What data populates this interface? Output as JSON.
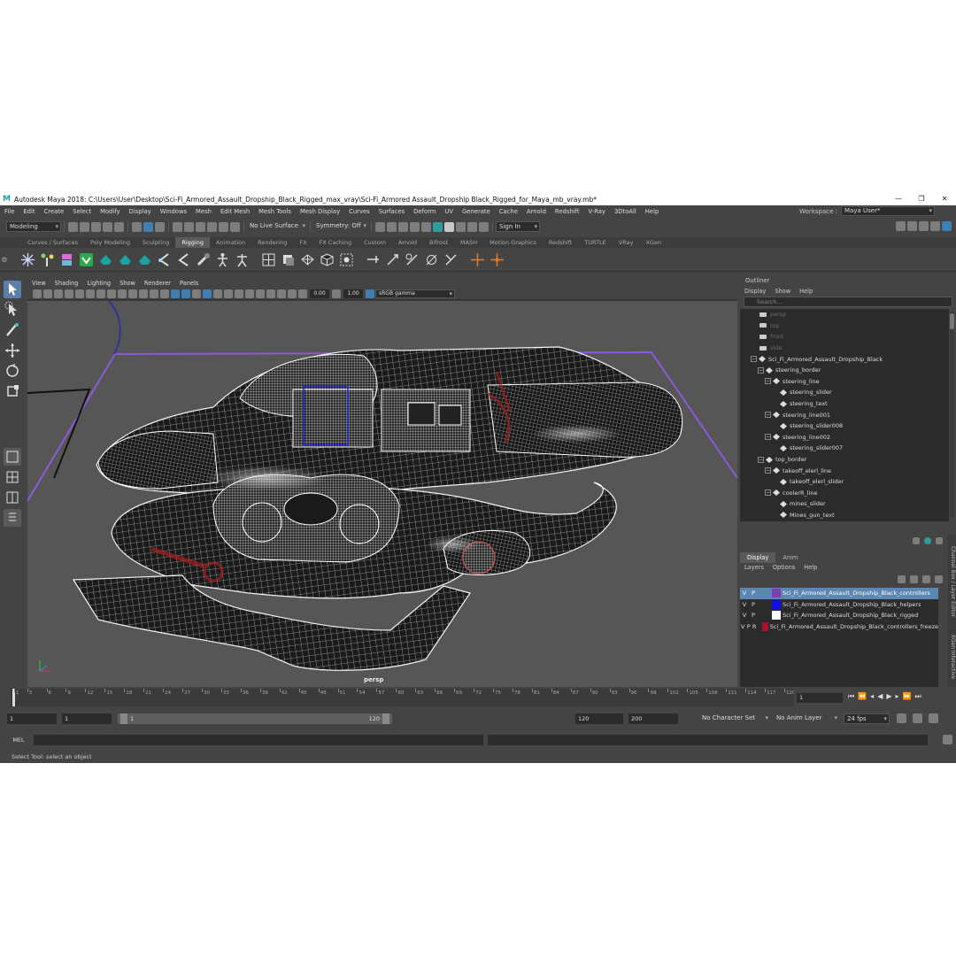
{
  "window": {
    "title": "Autodesk Maya 2018: C:\\Users\\User\\Desktop\\Sci-Fi_Armored_Assault_Dropship_Black_Rigged_max_vray\\Sci-Fi_Armored Assault_Dropship Black_Rigged_for_Maya_mb_vray.mb*",
    "logo_glyph": "M"
  },
  "menubar": {
    "items": [
      "File",
      "Edit",
      "Create",
      "Select",
      "Modify",
      "Display",
      "Windows",
      "Mesh",
      "Edit Mesh",
      "Mesh Tools",
      "Mesh Display",
      "Curves",
      "Surfaces",
      "Deform",
      "UV",
      "Generate",
      "Cache",
      "Arnold",
      "Redshift",
      "V-Ray",
      "3DtoAll",
      "Help"
    ],
    "workspace_label": "Workspace :",
    "workspace_value": "Maya User*"
  },
  "statusline": {
    "menuset": "Modeling",
    "live_surface": "No Live Surface",
    "symmetry": "Symmetry: Off",
    "sign_in": "Sign In"
  },
  "shelf": {
    "tabs": [
      "Curves / Surfaces",
      "Poly Modeling",
      "Sculpting",
      "Rigging",
      "Animation",
      "Rendering",
      "FX",
      "FX Caching",
      "Custom",
      "Arnold",
      "Bifrost",
      "MASH",
      "Motion Graphics",
      "Redshift",
      "TURTLE",
      "VRay",
      "XGen"
    ],
    "active_tab": "Rigging"
  },
  "viewport": {
    "menu": [
      "View",
      "Shading",
      "Lighting",
      "Show",
      "Renderer",
      "Panels"
    ],
    "near_value": "0.00",
    "far_value": "1.00",
    "color_space": "sRGB gamma",
    "camera": "persp",
    "logo": "M"
  },
  "outliner": {
    "title": "Outliner",
    "menu": [
      "Display",
      "Show",
      "Help"
    ],
    "search_placeholder": "Search...",
    "items": [
      {
        "label": "persp",
        "kind": "camera",
        "indent": 0,
        "dim": true
      },
      {
        "label": "top",
        "kind": "camera",
        "indent": 0,
        "dim": true
      },
      {
        "label": "front",
        "kind": "camera",
        "indent": 0,
        "dim": true
      },
      {
        "label": "side",
        "kind": "camera",
        "indent": 0,
        "dim": true
      },
      {
        "label": "Sci_Fi_Armored_Assault_Dropship_Black",
        "kind": "group",
        "indent": 0,
        "dim": false
      },
      {
        "label": "steering_border",
        "kind": "curve",
        "indent": 1,
        "dim": false
      },
      {
        "label": "steering_line",
        "kind": "curve",
        "indent": 2,
        "dim": false
      },
      {
        "label": "steering_slider",
        "kind": "curve",
        "indent": 3,
        "dim": false
      },
      {
        "label": "steering_text",
        "kind": "curve",
        "indent": 3,
        "dim": false
      },
      {
        "label": "steering_line001",
        "kind": "curve",
        "indent": 2,
        "dim": false
      },
      {
        "label": "steering_slider008",
        "kind": "curve",
        "indent": 3,
        "dim": false
      },
      {
        "label": "steering_line002",
        "kind": "curve",
        "indent": 2,
        "dim": false
      },
      {
        "label": "steering_slider007",
        "kind": "curve",
        "indent": 3,
        "dim": false
      },
      {
        "label": "top_border",
        "kind": "curve",
        "indent": 1,
        "dim": false
      },
      {
        "label": "takeoff_elerl_line",
        "kind": "curve",
        "indent": 2,
        "dim": false
      },
      {
        "label": "takeoff_elerl_slider",
        "kind": "curve",
        "indent": 3,
        "dim": false
      },
      {
        "label": "coolerR_line",
        "kind": "curve",
        "indent": 2,
        "dim": false
      },
      {
        "label": "mines_slider",
        "kind": "curve",
        "indent": 3,
        "dim": false
      },
      {
        "label": "Mines_gun_text",
        "kind": "curve",
        "indent": 3,
        "dim": false
      }
    ]
  },
  "layer_editor": {
    "tabs": [
      "Display",
      "Anim"
    ],
    "active_tab": "Display",
    "menu": [
      "Layers",
      "Options",
      "Help"
    ],
    "layers": [
      {
        "v": "V",
        "p": "P",
        "r": "",
        "color": "#7b3fb0",
        "name": "Sci_Fi_Armored_Assault_Dropship_Black_controllers",
        "selected": true
      },
      {
        "v": "V",
        "p": "P",
        "r": "",
        "color": "#1010e0",
        "name": "Sci_Fi_Armored_Assault_Dropship_Black_helpers",
        "selected": false
      },
      {
        "v": "V",
        "p": "P",
        "r": "",
        "color": "#ffffff",
        "name": "Sci_Fi_Armored_Assault_Dropship_Black_rigged",
        "selected": false
      },
      {
        "v": "V",
        "p": "P",
        "r": "R",
        "color": "#b01030",
        "name": "Sci_Fi_Armored_Assault_Dropship_Black_controllers_freeze",
        "selected": false
      }
    ],
    "side_tabs": "Channel Box / Layer Editor",
    "side_tabs_2": "XGen Interactive"
  },
  "timeslider": {
    "ticks": [
      "1",
      "3",
      "6",
      "9",
      "12",
      "15",
      "18",
      "21",
      "24",
      "27",
      "30",
      "33",
      "36",
      "39",
      "42",
      "45",
      "48",
      "51",
      "54",
      "57",
      "60",
      "63",
      "66",
      "69",
      "72",
      "75",
      "78",
      "81",
      "84",
      "87",
      "90",
      "93",
      "96",
      "99",
      "102",
      "105",
      "108",
      "111",
      "114",
      "117",
      "120"
    ],
    "current_frame": "1"
  },
  "rangeslider": {
    "start": "1",
    "playback_start": "1",
    "range_start": "1",
    "range_end": "120",
    "playback_end": "120",
    "end": "200",
    "character_set": "No Character Set",
    "anim_layer": "No Anim Layer",
    "fps": "24 fps"
  },
  "cmdline": {
    "label": "MEL"
  },
  "helpline": {
    "text": "Select Tool: select an object"
  },
  "colors": {
    "accent": "#4a9fd8",
    "wire": "#ffffff",
    "ground_border": "#7a4bd0"
  }
}
